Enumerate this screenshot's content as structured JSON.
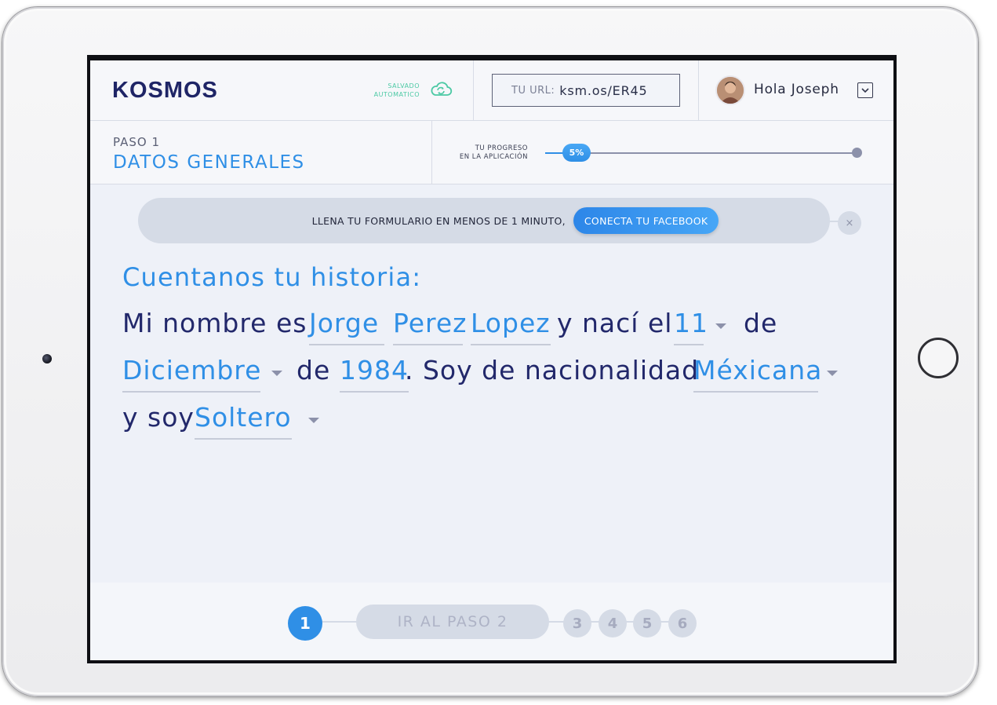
{
  "header": {
    "logo": "KOSMOS",
    "autosave": {
      "line1": "SALVADO",
      "line2": "AUTOMATICO",
      "icon": "cloud-sync-icon",
      "color": "#4cc9a4"
    },
    "url": {
      "label": "TU URL:",
      "value": "ksm.os/ER45"
    },
    "user": {
      "greeting": "Hola Joseph",
      "avatar_icon": "user-avatar",
      "dropdown_icon": "chevron-down-icon"
    }
  },
  "step": {
    "number_label": "PASO 1",
    "title": "DATOS GENERALES"
  },
  "progress": {
    "label_line1": "TU PROGRESO",
    "label_line2": "EN LA APLICACIÓN",
    "value_label": "5%",
    "value": 0.05
  },
  "banner": {
    "text": "LLENA TU FORMULARIO EN  MENOS DE 1 MINUTO,",
    "button_label": "CONECTA TU FACEBOOK",
    "close_label": "×"
  },
  "story": {
    "title": "Cuentanos tu historia:",
    "text": {
      "t1": "Mi nombre es",
      "t2": "y nací el",
      "t3": "de",
      "t4": "de",
      "t5": ". Soy de nacionalidad",
      "t6": "y soy"
    },
    "fields": {
      "first_name": "Jorge",
      "last_name_1": "Perez",
      "last_name_2": "Lopez",
      "day": "11",
      "month": "Diciembre",
      "year": "1984",
      "nationality": "Méxicana",
      "marital_status": "Soltero"
    }
  },
  "stepper": {
    "steps": [
      "1",
      "3",
      "4",
      "5",
      "6"
    ],
    "next_button": "IR AL PASO 2",
    "active_color": "#2f8fe6"
  }
}
